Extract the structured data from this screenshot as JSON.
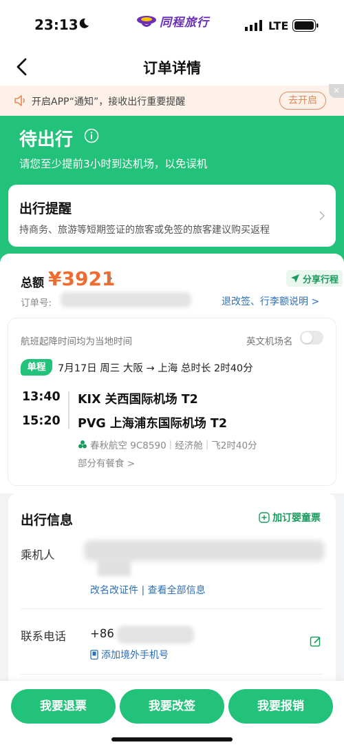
{
  "status_bar": {
    "time": "23:13",
    "network": "LTE"
  },
  "brand": {
    "name": "同程旅行",
    "color": "#6a2fb8"
  },
  "nav": {
    "title": "订单详情"
  },
  "notice": {
    "text": "开启APP“通知”，接收出行重要提醒",
    "button": "去开启",
    "close": "×"
  },
  "order_status": {
    "title": "待出行",
    "subtitle": "请您至少提前3小时到达机场，以免误机",
    "color": "#22c27a"
  },
  "reminder": {
    "title": "出行提醒",
    "text": "持商务、旅游等短期签证的旅客或免签的旅客建议购买返程"
  },
  "price": {
    "label": "总额",
    "amount": "¥3921",
    "share": "分享行程",
    "order_no_label": "订单号:",
    "rule_link": "退改签、行李额说明 >"
  },
  "flight": {
    "time_note": "航班起降时间均为当地时间",
    "en_airport_label": "英文机场名",
    "en_airport_toggle": false,
    "trip_type": "单程",
    "trip_info": "7月17日 周三 大阪 → 上海 总时长 2时40分",
    "departure": {
      "time": "13:40",
      "airport": "KIX 关西国际机场 T2"
    },
    "arrival": {
      "time": "15:20",
      "airport": "PVG 上海浦东国际机场 T2"
    },
    "airline": "春秋航空 9C8590",
    "cabin": "经济舱",
    "duration": "飞2时40分",
    "meal": "部分有餐食 >"
  },
  "travel_info": {
    "title": "出行信息",
    "add_infant": "加订婴童票",
    "passenger_label": "乘机人",
    "passenger_links": "改名改证件 | 查看全部信息",
    "phone_label": "联系电话",
    "phone_code": "+86",
    "add_phone": "添加境外手机号"
  },
  "actions": [
    "我要退票",
    "我要改签",
    "我要报销"
  ],
  "accent_colors": {
    "green": "#22c27a",
    "orange": "#ef6c30",
    "link": "#2c6fb8"
  }
}
